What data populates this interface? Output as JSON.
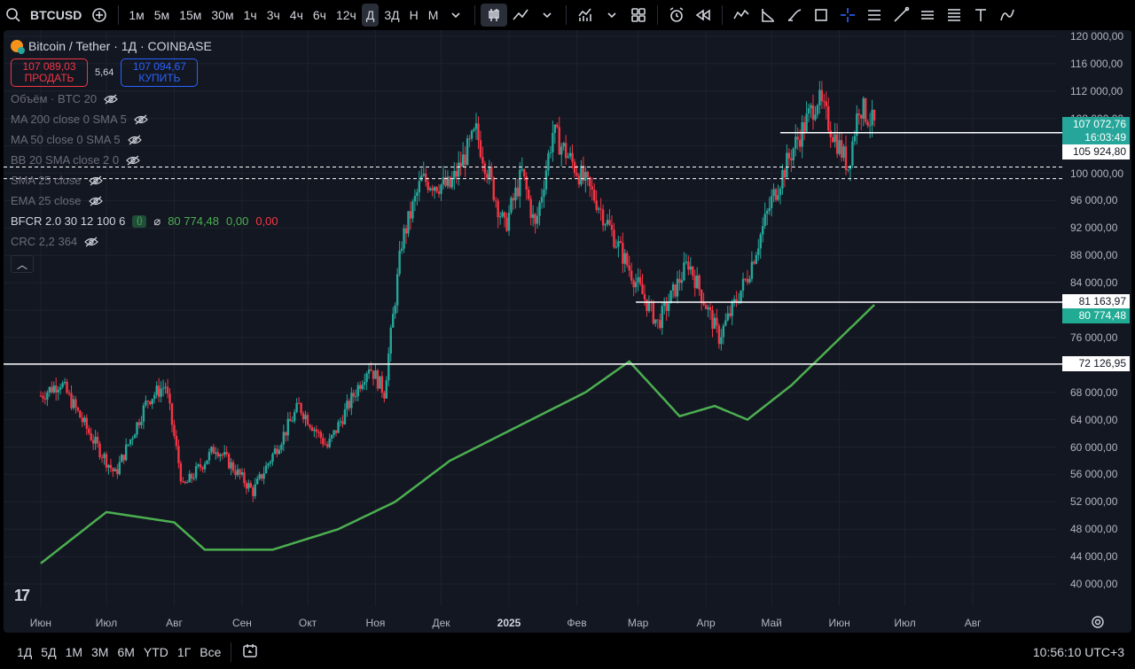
{
  "toolbar": {
    "symbol": "BTCUSD",
    "intervals": [
      "1м",
      "5м",
      "15м",
      "30м",
      "1ч",
      "3ч",
      "4ч",
      "6ч",
      "12ч",
      "Д",
      "3Д",
      "Н",
      "М"
    ],
    "active_interval": "Д",
    "icons": [
      "search-icon",
      "add-symbol-icon",
      "chevron-down-icon",
      "candles-icon",
      "line-style-icon",
      "chevron-down-icon",
      "indicators-icon",
      "layouts-icon",
      "alert-icon",
      "replay-icon",
      "trend-line-icon",
      "fib-icon",
      "brush-icon",
      "rect-icon",
      "crosshair-icon",
      "pitchfork-icon",
      "ray-icon",
      "channel-icon",
      "fib-levels-icon",
      "text-icon",
      "patterns-icon"
    ]
  },
  "legend": {
    "title": "Bitcoin / Tether · 1Д · COINBASE",
    "sell_price": "107 089,03",
    "sell_label": "ПРОДАТЬ",
    "spread": "5,64",
    "buy_price": "107 094,67",
    "buy_label": "КУПИТЬ",
    "indicators": [
      {
        "label": "Объём · BTC 20",
        "visible": false
      },
      {
        "label": "MA 200 close 0 SMA 5",
        "visible": false
      },
      {
        "label": "MA 50 close 0 SMA 5",
        "visible": false
      },
      {
        "label": "BB 20 SMA close 2 0",
        "visible": false
      },
      {
        "label": "SMA 25 close",
        "visible": false
      },
      {
        "label": "EMA 25 close",
        "visible": false
      }
    ],
    "bfcr": {
      "label": "BFCR 2.0 30 12 100 6",
      "symbol": "⌀",
      "v1": "80 774,48",
      "v2": "0,00",
      "v3": "0,00"
    },
    "crc": {
      "label": "CRC 2,2 364"
    }
  },
  "price_scale": {
    "ticks": [
      "120 000,00",
      "116 000,00",
      "112 000,00",
      "108 000,00",
      "104 000,00",
      "100 000,00",
      "96 000,00",
      "92 000,00",
      "88 000,00",
      "84 000,00",
      "80 000,00",
      "76 000,00",
      "72 000,00",
      "68 000,00",
      "64 000,00",
      "60 000,00",
      "56 000,00",
      "52 000,00",
      "48 000,00",
      "44 000,00",
      "40 000,00"
    ],
    "last_price": "107 072,76",
    "countdown": "16:03:49",
    "hline_1": "105 924,80",
    "hline_2": "81 163,97",
    "indicator_value": "80 774,48",
    "hline_3": "72 126,95"
  },
  "time_axis": [
    "Июн",
    "Июл",
    "Авг",
    "Сен",
    "Окт",
    "Ноя",
    "Дек",
    "2025",
    "Фев",
    "Мар",
    "Апр",
    "Май",
    "Июн",
    "Июл",
    "Авг"
  ],
  "bottom": {
    "ranges": [
      "1Д",
      "5Д",
      "1М",
      "3М",
      "6М",
      "YTD",
      "1Г",
      "Все"
    ],
    "clock": "10:56:10 UTC+3"
  },
  "colors": {
    "up": "#26a69a",
    "down": "#f23645",
    "indicator": "#4caf50",
    "bg": "#131722"
  },
  "chart_data": {
    "type": "candlestick",
    "series_key_points": [
      [
        "2024-06-01",
        67500
      ],
      [
        "2024-06-10",
        69500
      ],
      [
        "2024-06-25",
        61000
      ],
      [
        "2024-07-05",
        56000
      ],
      [
        "2024-07-20",
        67000
      ],
      [
        "2024-07-28",
        69000
      ],
      [
        "2024-08-05",
        54000
      ],
      [
        "2024-08-20",
        60000
      ],
      [
        "2024-09-06",
        53500
      ],
      [
        "2024-09-27",
        66000
      ],
      [
        "2024-10-10",
        60000
      ],
      [
        "2024-10-29",
        72000
      ],
      [
        "2024-11-05",
        68000
      ],
      [
        "2024-11-13",
        90000
      ],
      [
        "2024-11-22",
        99000
      ],
      [
        "2024-12-05",
        98000
      ],
      [
        "2024-12-17",
        106000
      ],
      [
        "2024-12-30",
        92000
      ],
      [
        "2025-01-07",
        100000
      ],
      [
        "2025-01-13",
        92000
      ],
      [
        "2025-01-21",
        106000
      ],
      [
        "2025-01-29",
        102000
      ],
      [
        "2025-02-10",
        96000
      ],
      [
        "2025-02-25",
        86000
      ],
      [
        "2025-03-10",
        78000
      ],
      [
        "2025-03-24",
        87000
      ],
      [
        "2025-04-07",
        76000
      ],
      [
        "2025-04-20",
        85000
      ],
      [
        "2025-05-01",
        96000
      ],
      [
        "2025-05-10",
        103000
      ],
      [
        "2025-05-22",
        111000
      ],
      [
        "2025-06-05",
        101000
      ],
      [
        "2025-06-10",
        110000
      ],
      [
        "2025-06-17",
        107000
      ]
    ],
    "indicator_key_points": [
      [
        "2024-06-01",
        43000
      ],
      [
        "2024-07-01",
        50500
      ],
      [
        "2024-08-01",
        49000
      ],
      [
        "2024-08-15",
        45000
      ],
      [
        "2024-09-15",
        45000
      ],
      [
        "2024-10-15",
        48000
      ],
      [
        "2024-11-10",
        52000
      ],
      [
        "2024-12-05",
        58000
      ],
      [
        "2025-01-05",
        63000
      ],
      [
        "2025-02-05",
        68000
      ],
      [
        "2025-02-25",
        72500
      ],
      [
        "2025-03-20",
        64500
      ],
      [
        "2025-04-05",
        66000
      ],
      [
        "2025-04-20",
        64000
      ],
      [
        "2025-05-10",
        69000
      ],
      [
        "2025-06-17",
        80774.48
      ]
    ],
    "horizontal_lines": [
      105924.8,
      81163.97,
      72126.95,
      100900,
      99200
    ],
    "ylim": [
      38000,
      122000
    ]
  }
}
